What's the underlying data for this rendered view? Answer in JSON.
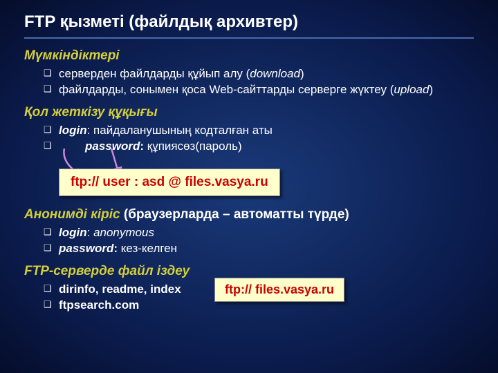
{
  "title": "FTP қызметі (файлдық архивтер)",
  "sections": {
    "capabilities": {
      "heading": "Мүмкіндіктері",
      "items": [
        {
          "text_before": "серверден файлдарды құйып алу (",
          "italic": "download",
          "text_after": ")"
        },
        {
          "text_before": "файлдарды, сонымен қоса Web-сайттарды серверге жүктеу (",
          "italic": "upload",
          "text_after": ")"
        }
      ]
    },
    "access": {
      "heading": "Қол жеткізу құқығы",
      "items": [
        {
          "bold_italic": "login",
          "rest": ": пайдаланушының кодталған аты"
        },
        {
          "bold_italic": "password",
          "bold": ":",
          "rest": " құпиясөз(пароль)",
          "indent": true
        }
      ]
    },
    "callout1": "ftp:// user : asd @ files.vasya.ru",
    "anonymous": {
      "heading_italic": "Анонимді кіріс",
      "heading_rest": " (браузерларда – автоматты түрде)",
      "items": [
        {
          "bold_italic": "login",
          "rest": ": ",
          "italic_rest": "anonymous"
        },
        {
          "bold_italic": "password",
          "bold": ":",
          "rest": " кез-келген"
        }
      ]
    },
    "callout2": "ftp:// files.vasya.ru",
    "search": {
      "heading": "FTP-серверде файл іздеу",
      "items": [
        {
          "bold": "dirinfo, readme, index"
        },
        {
          "bold": "ftpsearch.com"
        }
      ]
    }
  }
}
